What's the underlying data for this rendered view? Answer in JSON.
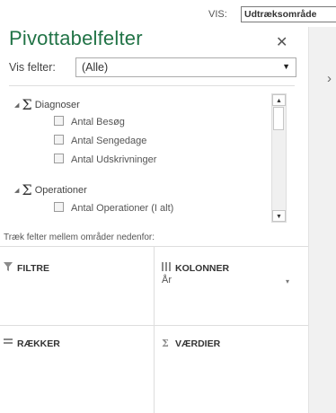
{
  "header": {
    "vis_label": "VIS:",
    "vis_value": "Udtræksområde",
    "title": "Pivottabelfelter",
    "close": "✕"
  },
  "filter": {
    "label": "Vis felter:",
    "value": "(Alle)",
    "caret": "▼"
  },
  "field_list": {
    "groups": [
      {
        "name": "Diagnoser",
        "fields": [
          "Antal Besøg",
          "Antal Sengedage",
          "Antal Udskrivninger"
        ]
      },
      {
        "name": "Operationer",
        "fields": [
          "Antal Operationer (I alt)"
        ]
      }
    ]
  },
  "areas": {
    "hint": "Træk felter mellem områder nedenfor:",
    "filters": {
      "label": "FILTRE",
      "icon": "filter-icon"
    },
    "columns": {
      "label": "KOLONNER",
      "icon": "columns-icon",
      "items": [
        "År"
      ]
    },
    "rows": {
      "label": "RÆKKER",
      "icon": "rows-icon"
    },
    "values": {
      "label": "VÆRDIER",
      "icon": "sigma-icon"
    }
  },
  "icons": {
    "expand": "◢",
    "sigma": "Σ",
    "collapse": "›",
    "dropdown": "▾",
    "scroll_up": "▲",
    "scroll_down": "▼"
  },
  "colors": {
    "title": "#217346",
    "strip": "#f1f1f1"
  }
}
